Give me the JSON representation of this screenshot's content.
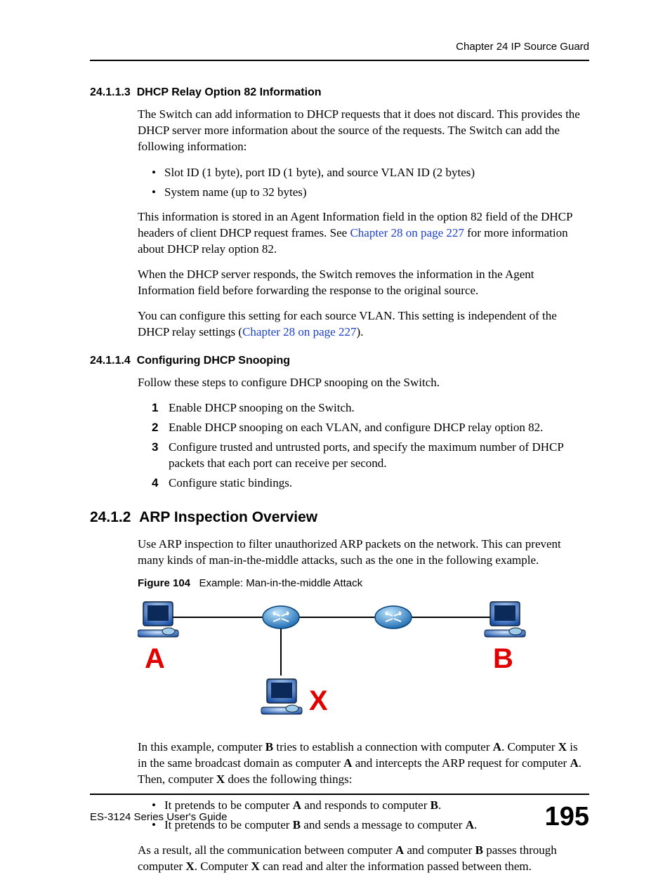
{
  "header": {
    "chapter": "Chapter 24 IP Source Guard"
  },
  "sec1": {
    "num": "24.1.1.3",
    "title": "DHCP Relay Option 82 Information",
    "p1": "The Switch can add information to DHCP requests that it does not discard. This provides the DHCP server more information about the source of the requests. The Switch can add the following information:",
    "b1": "Slot ID (1 byte), port ID (1 byte), and source VLAN ID (2 bytes)",
    "b2": "System name (up to 32 bytes)",
    "p2a": "This information is stored in an Agent Information field in the option 82 field of the DHCP headers of client DHCP request frames. See ",
    "p2link": "Chapter 28 on page 227",
    "p2b": " for more information about DHCP relay option 82.",
    "p3": "When the DHCP server responds, the Switch removes the information in the Agent Information field before forwarding the response to the original source.",
    "p4a": "You can configure this setting for each source VLAN. This setting is independent of the DHCP relay settings (",
    "p4link": "Chapter 28 on page 227",
    "p4b": ")."
  },
  "sec2": {
    "num": "24.1.1.4",
    "title": "Configuring DHCP Snooping",
    "p1": "Follow these steps to configure DHCP snooping on the Switch.",
    "s1": "Enable DHCP snooping on the Switch.",
    "s2": "Enable DHCP snooping on each VLAN, and configure DHCP relay option 82.",
    "s3": "Configure trusted and untrusted ports, and specify the maximum number of DHCP packets that each port can receive per second.",
    "s4": "Configure static bindings."
  },
  "sec3": {
    "num": "24.1.2",
    "title": "ARP Inspection Overview",
    "p1": "Use ARP inspection to filter unauthorized ARP packets on the network. This can prevent many kinds of man-in-the-middle attacks, such as the one in the following example.",
    "figlabel": "Figure 104",
    "figtitle": "Example: Man-in-the-middle Attack",
    "labelA": "A",
    "labelB": "B",
    "labelX": "X",
    "p2a": "In this example, computer ",
    "p2b": " tries to establish a connection with computer ",
    "p2c": ". Computer ",
    "p2d": " is in the same broadcast domain as computer ",
    "p2e": " and intercepts the ARP request for computer ",
    "p2f": ". Then, computer ",
    "p2g": " does the following things:",
    "bx1a": "It pretends to be computer ",
    "bx1b": " and responds to computer ",
    "bx1c": ".",
    "bx2a": "It pretends to be computer ",
    "bx2b": " and sends a message to computer ",
    "bx2c": ".",
    "p3a": "As a result, all the communication between computer ",
    "p3b": " and computer ",
    "p3c": " passes through computer ",
    "p3d": ". Computer ",
    "p3e": " can read and alter the information passed between them.",
    "A": "A",
    "B": "B",
    "X": "X"
  },
  "footer": {
    "guide": "ES-3124 Series User's Guide",
    "page": "195"
  }
}
